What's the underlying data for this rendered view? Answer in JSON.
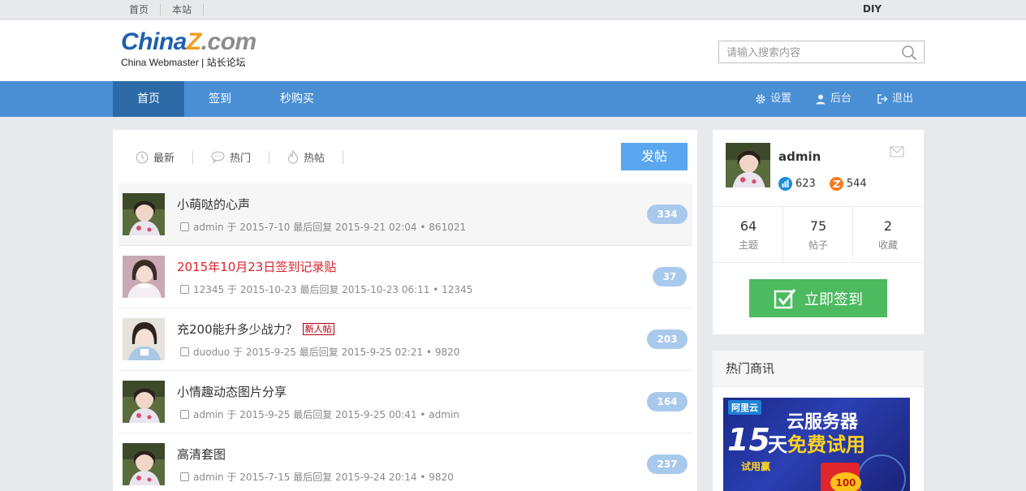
{
  "topbar": {
    "links": [
      "首页",
      "本站"
    ],
    "diy": "DIY"
  },
  "logo": {
    "word_part1": "China",
    "word_part2": "Z",
    "word_part3": ".com",
    "subtitle": "China Webmaster | 站长论坛",
    "colors": {
      "blue": "#1f5fae",
      "orange": "#f39c1f",
      "gray": "#8c8c8c"
    }
  },
  "search": {
    "placeholder": "请输入搜索内容",
    "icon": "search-icon"
  },
  "nav": {
    "items": [
      "首页",
      "签到",
      "秒购买"
    ],
    "active_index": 0,
    "right": [
      {
        "label": "设置",
        "icon": "gear-icon"
      },
      {
        "label": "后台",
        "icon": "user-icon"
      },
      {
        "label": "退出",
        "icon": "logout-icon"
      }
    ],
    "colors": {
      "bar": "#4a8fd4",
      "active": "#2c6aa7"
    }
  },
  "main": {
    "tabs": [
      {
        "label": "最新",
        "icon": "clock-icon"
      },
      {
        "label": "热门",
        "icon": "chat-bubble-icon"
      },
      {
        "label": "热帖",
        "icon": "flame-icon"
      }
    ],
    "post_button": "发帖",
    "threads": [
      {
        "title": "小萌哒的心声",
        "author": "admin",
        "sep1": "于",
        "date": "2015-7-10",
        "reply_label": "最后回复",
        "reply_time": "2015-9-21 02:04",
        "dot": "•",
        "last_user": "861021",
        "count": "334",
        "red": false,
        "badge": ""
      },
      {
        "title": "2015年10月23日签到记录贴",
        "author": "12345",
        "sep1": "于",
        "date": "2015-10-23",
        "reply_label": "最后回复",
        "reply_time": "2015-10-23 06:11",
        "dot": "•",
        "last_user": "12345",
        "count": "37",
        "red": true,
        "badge": ""
      },
      {
        "title": "充200能升多少战力？",
        "author": "duoduo",
        "sep1": "于",
        "date": "2015-9-25",
        "reply_label": "最后回复",
        "reply_time": "2015-9-25 02:21",
        "dot": "•",
        "last_user": "9820",
        "count": "203",
        "red": false,
        "badge": "新人帖"
      },
      {
        "title": "小情趣动态图片分享",
        "author": "admin",
        "sep1": "于",
        "date": "2015-9-25",
        "reply_label": "最后回复",
        "reply_time": "2015-9-25 00:41",
        "dot": "•",
        "last_user": "admin",
        "count": "164",
        "red": false,
        "badge": ""
      },
      {
        "title": "高清套图",
        "author": "admin",
        "sep1": "于",
        "date": "2015-7-15",
        "reply_label": "最后回复",
        "reply_time": "2015-9-24 20:14",
        "dot": "•",
        "last_user": "9820",
        "count": "237",
        "red": false,
        "badge": ""
      }
    ]
  },
  "profile": {
    "username": "admin",
    "score1": "623",
    "score2": "544",
    "stats": [
      {
        "num": "64",
        "label": "主题"
      },
      {
        "num": "75",
        "label": "帖子"
      },
      {
        "num": "2",
        "label": "收藏"
      }
    ],
    "checkin_label": "立即签到",
    "colors": {
      "checkin": "#4cba5f",
      "score1": "#1b8ed6",
      "score2": "#f47b20"
    }
  },
  "hot": {
    "title": "热门商讯",
    "ad": {
      "brand": "阿里云",
      "line1": "云服务器",
      "big": "15",
      "line2_white": "天",
      "line2_yellow": "免费试用",
      "tag": "试用赢",
      "coin": "100"
    }
  }
}
